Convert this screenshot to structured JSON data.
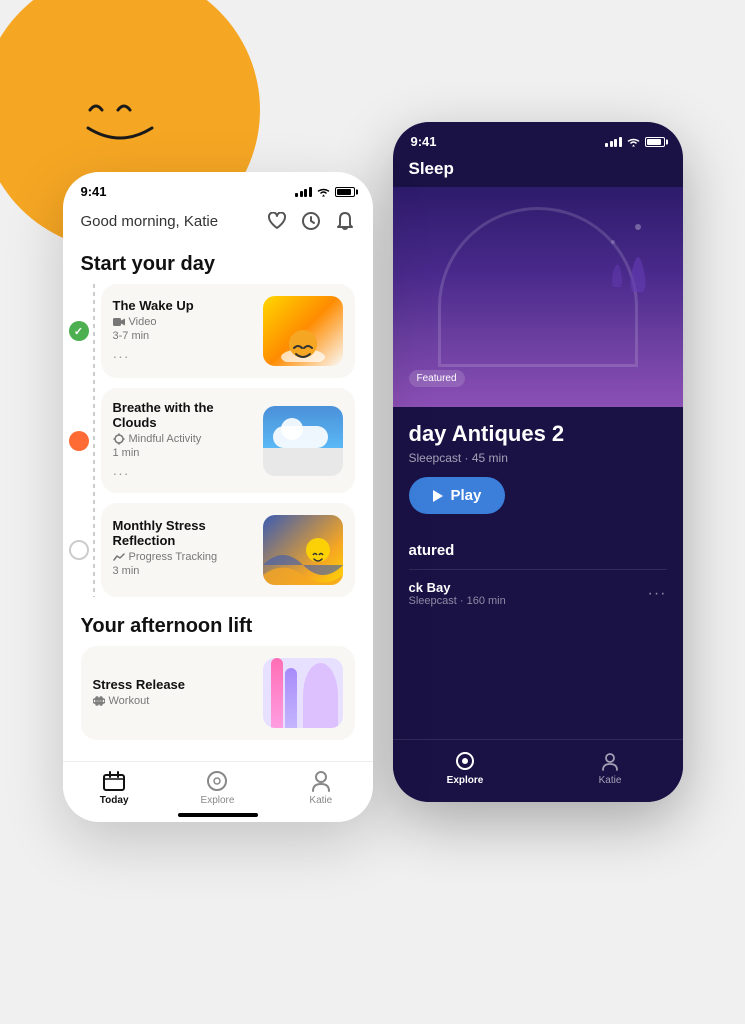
{
  "sun": {
    "face_alt": "Happy sun face"
  },
  "white_phone": {
    "status_bar": {
      "time": "9:41"
    },
    "header": {
      "greeting": "Good morning, Katie",
      "icons": [
        "heart",
        "clock",
        "bell"
      ]
    },
    "section1": {
      "title": "Start your day",
      "activities": [
        {
          "id": "wake-up",
          "title": "The Wake Up",
          "type": "Video",
          "duration": "3-7 min",
          "status": "completed",
          "image": "wake-up"
        },
        {
          "id": "breathe",
          "title": "Breathe with the Clouds",
          "type": "Mindful Activity",
          "duration": "1 min",
          "status": "active",
          "image": "breathe"
        },
        {
          "id": "stress",
          "title": "Monthly Stress Reflection",
          "type": "Progress Tracking",
          "duration": "3 min",
          "status": "empty",
          "image": "stress"
        }
      ]
    },
    "section2": {
      "title": "Your afternoon lift",
      "activities": [
        {
          "id": "stress-release",
          "title": "Stress Release",
          "type": "Workout",
          "image": "stress-release"
        }
      ]
    },
    "bottom_nav": {
      "items": [
        {
          "id": "today",
          "label": "Today",
          "active": true
        },
        {
          "id": "explore",
          "label": "Explore",
          "active": false
        },
        {
          "id": "katie",
          "label": "Katie",
          "active": false
        }
      ]
    }
  },
  "dark_phone": {
    "status_bar": {
      "time": "9:41"
    },
    "header": {
      "title": "Sleep"
    },
    "hero": {
      "featured_badge": "Featured",
      "title": "day Antiques 2",
      "subtitle": "Sleepcast · 45 min"
    },
    "play_button": "Play",
    "featured_section": {
      "label": "atured",
      "items": [
        {
          "title": "ck Bay",
          "subtitle": "Sleepcast · 160 min"
        }
      ]
    },
    "bottom_nav": {
      "items": [
        {
          "id": "explore",
          "label": "Explore",
          "active": true
        },
        {
          "id": "katie",
          "label": "Katie",
          "active": false
        }
      ]
    }
  }
}
